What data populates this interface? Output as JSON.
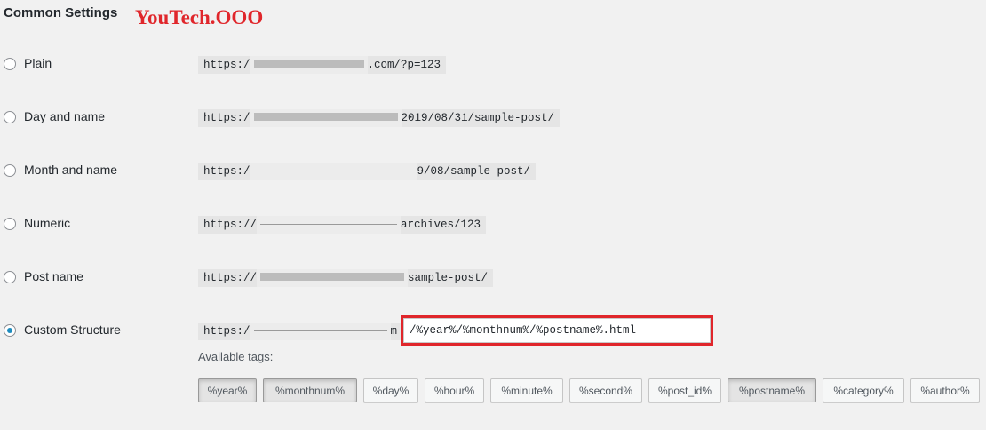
{
  "section": {
    "title": "Common Settings",
    "watermark": "YouTech.OOO"
  },
  "options": [
    {
      "label": "Plain",
      "checked": false,
      "url_prefix": "https:/",
      "url_suffix": ".com/?p=123"
    },
    {
      "label": "Day and name",
      "checked": false,
      "url_prefix": "https:/",
      "url_suffix": "2019/08/31/sample-post/"
    },
    {
      "label": "Month and name",
      "checked": false,
      "url_prefix": "https:/",
      "url_suffix": "9/08/sample-post/"
    },
    {
      "label": "Numeric",
      "checked": false,
      "url_prefix": "https://",
      "url_suffix": "archives/123"
    },
    {
      "label": "Post name",
      "checked": false,
      "url_prefix": "https://",
      "url_suffix": "sample-post/"
    },
    {
      "label": "Custom Structure",
      "checked": true,
      "url_prefix": "https:/",
      "url_suffix": "m"
    }
  ],
  "custom_structure": {
    "value": "/%year%/%monthnum%/%postname%.html"
  },
  "available_tags_label": "Available tags:",
  "tags": [
    {
      "label": "%year%",
      "active": true
    },
    {
      "label": "%monthnum%",
      "active": true
    },
    {
      "label": "%day%",
      "active": false
    },
    {
      "label": "%hour%",
      "active": false
    },
    {
      "label": "%minute%",
      "active": false
    },
    {
      "label": "%second%",
      "active": false
    },
    {
      "label": "%post_id%",
      "active": false
    },
    {
      "label": "%postname%",
      "active": true
    },
    {
      "label": "%category%",
      "active": false
    },
    {
      "label": "%author%",
      "active": false
    }
  ],
  "colors": {
    "highlight_box": "#e0262b",
    "watermark": "#e0262b",
    "radio_checked": "#1e8cbe"
  }
}
